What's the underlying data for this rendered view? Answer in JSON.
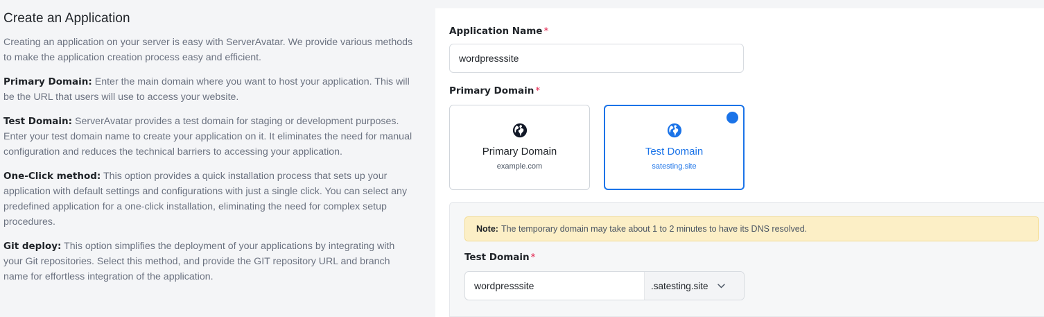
{
  "info": {
    "heading": "Create an Application",
    "intro": "Creating an application on your server is easy with ServerAvatar. We provide various methods to make the application creation process easy and efficient.",
    "sections": [
      {
        "term": "Primary Domain:",
        "text": " Enter the main domain where you want to host your application. This will be the URL that users will use to access your website."
      },
      {
        "term": "Test Domain:",
        "text": " ServerAvatar provides a test domain for staging or development purposes. Enter your test domain name to create your application on it. It eliminates the need for manual configuration and reduces the technical barriers to accessing your application."
      },
      {
        "term": "One-Click method:",
        "text": " This option provides a quick installation process that sets up your application with default settings and configurations with just a single click. You can select any predefined application for a one-click installation, eliminating the need for complex setup procedures."
      },
      {
        "term": "Git deploy:",
        "text": " This option simplifies the deployment of your applications by integrating with your Git repositories. Select this method, and provide the GIT repository URL and branch name for effortless integration of the application."
      }
    ]
  },
  "form": {
    "app_name_label": "Application Name",
    "app_name_value": "wordpresssite",
    "required_mark": "*",
    "primary_domain_label": "Primary Domain",
    "options": [
      {
        "title": "Primary Domain",
        "sub": "example.com",
        "icon": "globe-icon",
        "selected": false
      },
      {
        "title": "Test Domain",
        "sub": "satesting.site",
        "icon": "globe-icon",
        "selected": true
      }
    ],
    "note_label": "Note:",
    "note_text": "The temporary domain may take about 1 to 2 minutes to have its DNS resolved.",
    "test_domain_label": "Test Domain",
    "test_domain_value": "wordpresssite",
    "test_domain_suffix": ".satesting.site"
  },
  "colors": {
    "accent": "#1a73e8",
    "required": "#e11d48",
    "note_bg": "#fcefc6"
  }
}
